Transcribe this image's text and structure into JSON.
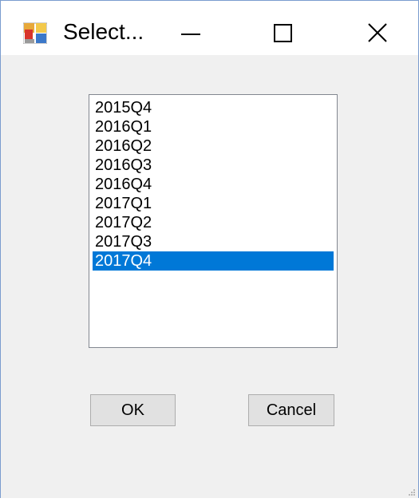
{
  "window": {
    "title": "Select..."
  },
  "icons": {
    "app": "application-icon",
    "minimize": "minimize-icon",
    "maximize": "maximize-icon",
    "close": "close-icon",
    "grip": "resize-grip-icon"
  },
  "colors": {
    "selection": "#0078d7",
    "window_bg": "#f0f0f0",
    "button_bg": "#e1e1e1"
  },
  "list": {
    "items": [
      "2015Q4",
      "2016Q1",
      "2016Q2",
      "2016Q3",
      "2016Q4",
      "2017Q1",
      "2017Q2",
      "2017Q3",
      "2017Q4"
    ],
    "selected_index": 8
  },
  "buttons": {
    "ok_label": "OK",
    "cancel_label": "Cancel"
  }
}
